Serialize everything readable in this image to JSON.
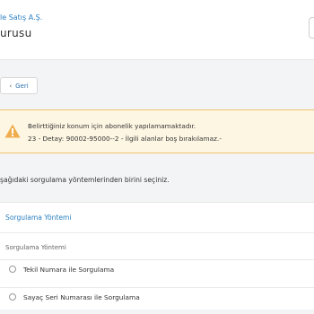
{
  "header": {
    "company": "le Satış A.Ş.",
    "title": "urusu"
  },
  "back_button": {
    "label": "Geri"
  },
  "alert": {
    "icon": "warning-triangle-icon",
    "color": "#f0ad4e",
    "line1": "Belirttiğiniz konum için abonelik yapılamamaktadır.",
    "line2": "23 - Detay: 90002-95000--2 - İlgili alanlar boş bırakılamaz.-"
  },
  "instruction": "şağıdaki sorgulama yöntemlerinden birini seçiniz.",
  "query_card": {
    "title": "Sorgulama Yöntemi",
    "field_label": "Sorgulama Yöntemi",
    "options": [
      "Tekil Numara ile Sorgulama",
      "Sayaç Seri Numarası ile Sorgulama"
    ]
  },
  "colors": {
    "accent": "#2a7fc0",
    "alert_bg": "#fdf6e3",
    "alert_border": "#f0c36d"
  }
}
